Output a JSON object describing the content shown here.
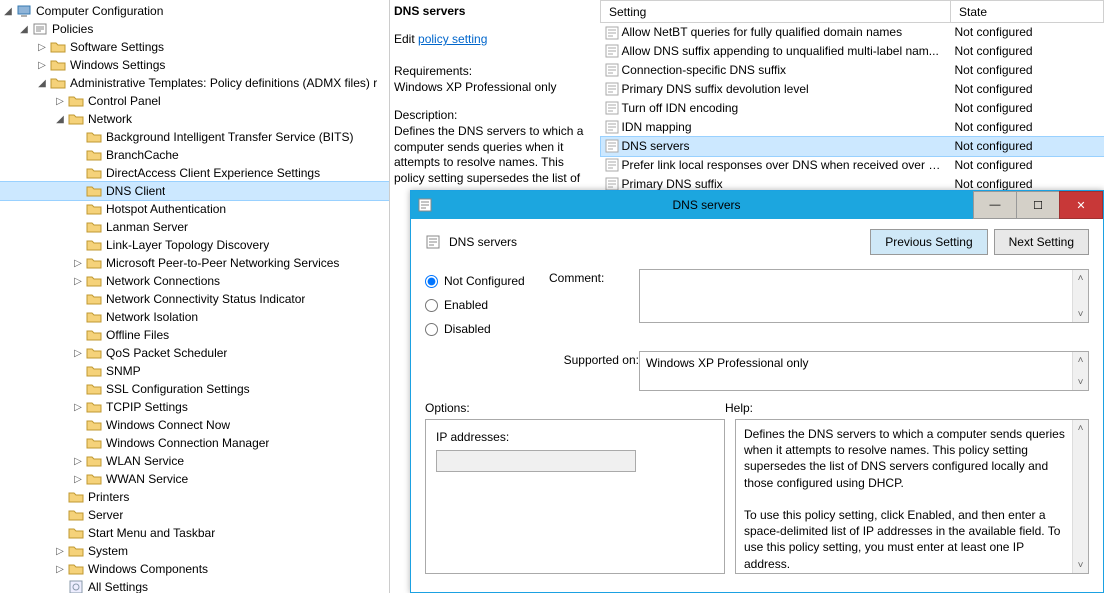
{
  "tree": {
    "root": "Computer Configuration",
    "policies": "Policies",
    "software": "Software Settings",
    "windows": "Windows Settings",
    "admt": "Administrative Templates: Policy definitions (ADMX files) r",
    "cpanel": "Control Panel",
    "network": "Network",
    "net_items": [
      "Background Intelligent Transfer Service (BITS)",
      "BranchCache",
      "DirectAccess Client Experience Settings",
      "DNS Client",
      "Hotspot Authentication",
      "Lanman Server",
      "Link-Layer Topology Discovery",
      "Microsoft Peer-to-Peer Networking Services",
      "Network Connections",
      "Network Connectivity Status Indicator",
      "Network Isolation",
      "Offline Files",
      "QoS Packet Scheduler",
      "SNMP",
      "SSL Configuration Settings",
      "TCPIP Settings",
      "Windows Connect Now",
      "Windows Connection Manager",
      "WLAN Service",
      "WWAN Service"
    ],
    "tail": [
      "Printers",
      "Server",
      "Start Menu and Taskbar",
      "System",
      "Windows Components",
      "All Settings"
    ]
  },
  "detail": {
    "title": "DNS servers",
    "edit": "Edit",
    "policy_link": "policy setting",
    "req_label": "Requirements:",
    "req_text": "Windows XP Professional only",
    "desc_label": "Description:",
    "desc_text": "Defines the DNS servers to which a computer sends queries when it attempts to resolve names. This policy setting supersedes the list of"
  },
  "table": {
    "headers": [
      "Setting",
      "State"
    ],
    "rows": [
      {
        "name": "Allow NetBT queries for fully qualified domain names",
        "state": "Not configured"
      },
      {
        "name": "Allow DNS suffix appending to unqualified multi-label nam...",
        "state": "Not configured"
      },
      {
        "name": "Connection-specific DNS suffix",
        "state": "Not configured"
      },
      {
        "name": "Primary DNS suffix devolution level",
        "state": "Not configured"
      },
      {
        "name": "Turn off IDN encoding",
        "state": "Not configured"
      },
      {
        "name": "IDN mapping",
        "state": "Not configured"
      },
      {
        "name": "DNS servers",
        "state": "Not configured"
      },
      {
        "name": "Prefer link local responses over DNS when received over a n...",
        "state": "Not configured"
      },
      {
        "name": "Primary DNS suffix",
        "state": "Not configured"
      }
    ]
  },
  "dialog": {
    "title": "DNS servers",
    "heading": "DNS servers",
    "prev": "Previous Setting",
    "next": "Next Setting",
    "radio_notconf": "Not Configured",
    "radio_enabled": "Enabled",
    "radio_disabled": "Disabled",
    "comment_label": "Comment:",
    "supported_label": "Supported on:",
    "supported_text": "Windows XP Professional only",
    "options_label": "Options:",
    "help_label": "Help:",
    "ip_label": "IP addresses:",
    "help_p1": "Defines the DNS servers to which a computer sends queries when it attempts to resolve names. This policy setting supersedes the list of DNS servers configured locally and those configured using DHCP.",
    "help_p2": "To use this policy setting, click Enabled, and then enter a space-delimited list of IP addresses in the available field. To use this policy setting, you must enter at least one IP address."
  }
}
